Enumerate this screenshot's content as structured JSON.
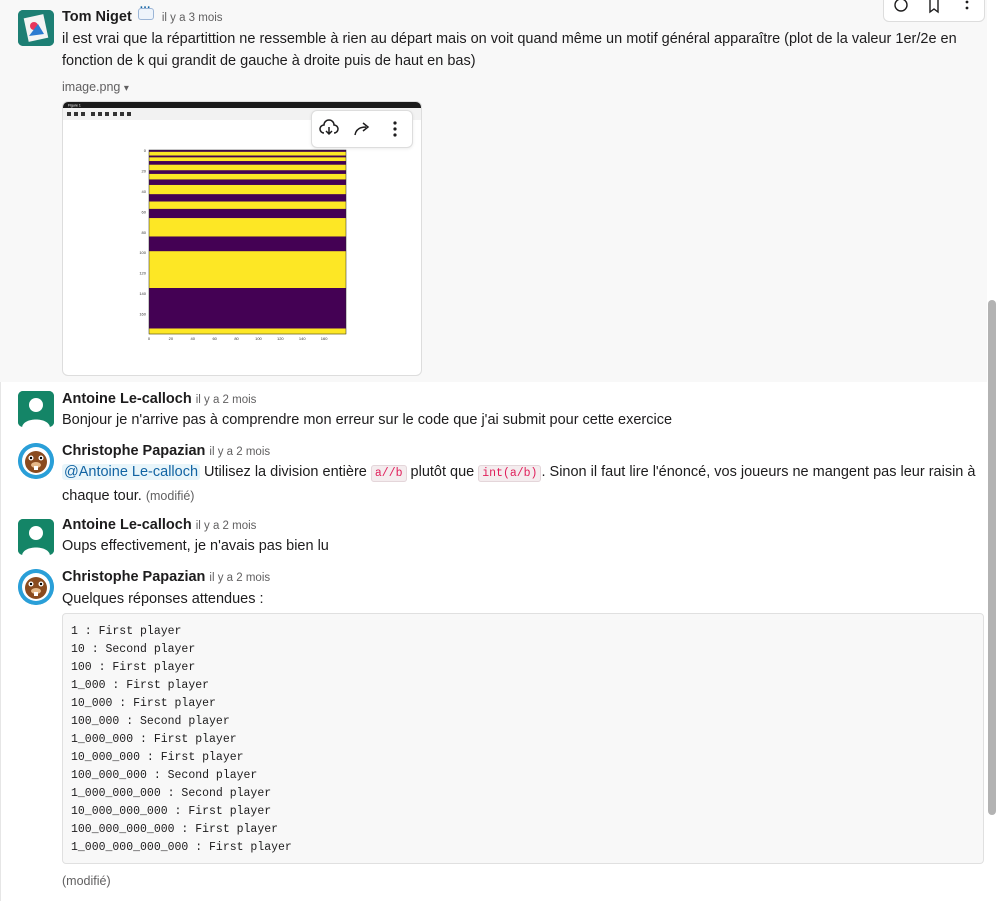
{
  "colors": {
    "highlight_bg": "#f8f8f8",
    "mention": "#1264a3",
    "code_inline": "#e01e5a",
    "viridis_yellow": "#fde725",
    "viridis_purple": "#440154"
  },
  "messages": [
    {
      "author": "Tom Niget",
      "time": "il y a 3 mois",
      "text": "il est vrai que la répartittion ne ressemble à rien au départ mais on voit quand même un motif général apparaître (plot de la valeur 1er/2e en fonction de k qui grandit de gauche à droite puis de haut en bas)",
      "attachment": "image.png",
      "attachment_chevron": "▾"
    },
    {
      "author": "Antoine Le-calloch",
      "time": "il y a 2 mois",
      "text": "Bonjour je n'arrive pas à comprendre mon erreur sur le code que j'ai submit pour cette exercice"
    },
    {
      "author": "Christophe Papazian",
      "time": "il y a 2 mois",
      "mention": "@Antoine Le-calloch",
      "part1": " Utilisez la division entière ",
      "code1": "a//b",
      "part2": " plutôt que ",
      "code2": "int(a/b)",
      "part3": ". Sinon il faut lire l'énoncé, vos joueurs ne mangent pas leur raisin à chaque tour. ",
      "edited": "(modifié)"
    },
    {
      "author": "Antoine Le-calloch",
      "time": "il y a 2 mois",
      "text": "Oups effectivement, je n'avais pas bien lu"
    },
    {
      "author": "Christophe Papazian",
      "time": "il y a 2 mois",
      "text": "Quelques réponses attendues :",
      "code_lines": [
        "1 : First player",
        "10 : Second player",
        "100 : First player",
        "1_000 : First player",
        "10_000 : First player",
        "100_000 : Second player",
        "1_000_000 : First player",
        "10_000_000 : First player",
        "100_000_000 : Second player",
        "1_000_000_000 : Second player",
        "10_000_000_000 : First player",
        "100_000_000_000 : First player",
        "1_000_000_000_000 : First player"
      ],
      "edited": "(modifié)"
    }
  ],
  "embedded_plot": {
    "window_title": "Figure 1",
    "y_ticks": [
      "0",
      "20",
      "40",
      "60",
      "80",
      "100",
      "120",
      "140",
      "160"
    ],
    "x_ticks": [
      "0",
      "20",
      "40",
      "60",
      "80",
      "100",
      "120",
      "140",
      "160"
    ],
    "rows_from_top": [
      {
        "color": "purple",
        "span": 0.01
      },
      {
        "color": "yellow",
        "span": 0.02
      },
      {
        "color": "purple",
        "span": 0.01
      },
      {
        "color": "yellow",
        "span": 0.02
      },
      {
        "color": "purple",
        "span": 0.02
      },
      {
        "color": "yellow",
        "span": 0.03
      },
      {
        "color": "purple",
        "span": 0.02
      },
      {
        "color": "yellow",
        "span": 0.03
      },
      {
        "color": "purple",
        "span": 0.03
      },
      {
        "color": "yellow",
        "span": 0.05
      },
      {
        "color": "purple",
        "span": 0.04
      },
      {
        "color": "yellow",
        "span": 0.04
      },
      {
        "color": "purple",
        "span": 0.05
      },
      {
        "color": "yellow",
        "span": 0.1
      },
      {
        "color": "purple",
        "span": 0.08
      },
      {
        "color": "yellow",
        "span": 0.2
      },
      {
        "color": "purple",
        "span": 0.22
      },
      {
        "color": "yellow",
        "span": 0.03
      }
    ]
  }
}
